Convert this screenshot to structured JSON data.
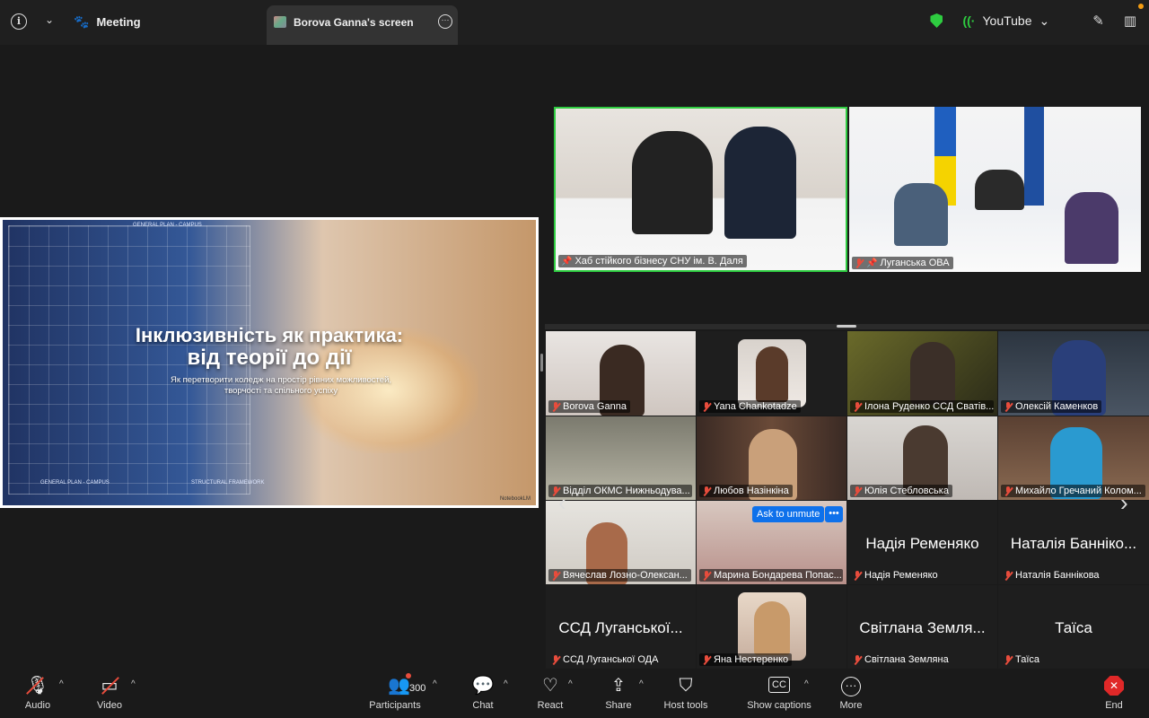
{
  "topbar": {
    "meeting_label": "Meeting",
    "tab_title": "Borova Ganna's screen",
    "stream_label": "YouTube",
    "stream_chevron": "⌄"
  },
  "slide": {
    "title_line1": "Інклюзивність як практика:",
    "title_line2": "від теорії до дії",
    "subtitle": "Як перетворити коледж на простір рівних можливостей, творчості та спільного успіху",
    "bp_label_top": "GENERAL PLAN - CAMPUS",
    "bp_label_bottom_left": "GENERAL PLAN - CAMPUS",
    "bp_label_bottom_mid": "STRUCTURAL FRAMEWORK",
    "watermark": "NotebookLM"
  },
  "participants": [
    {
      "id": "hub",
      "name": "Хаб стійкого бізнесу СНУ ім. В. Даля"
    },
    {
      "id": "lug",
      "name": "Луганська ОВА"
    },
    {
      "id": "p1",
      "name": "Borova Ganna"
    },
    {
      "id": "p2",
      "name": "Yana Chankotadze"
    },
    {
      "id": "p3",
      "name": "Ілона Руденко ССД Сватів..."
    },
    {
      "id": "p4",
      "name": "Олексій Каменков"
    },
    {
      "id": "p5",
      "name": "Відділ ОКМС Нижньодува..."
    },
    {
      "id": "p6",
      "name": "Любов Назінкіна"
    },
    {
      "id": "p7",
      "name": "Юлія Стебловська"
    },
    {
      "id": "p8",
      "name": "Михайло Гречаний Колом..."
    },
    {
      "id": "p9",
      "name": "Вячеслав Лозно-Олексан..."
    },
    {
      "id": "p10",
      "name": "Марина Бондарева Попас..."
    },
    {
      "id": "p11",
      "name": "Надія Ременяко",
      "big": "Надія Ременяко"
    },
    {
      "id": "p12",
      "name": "Наталія Баннікова",
      "big": "Наталія Баннікo..."
    },
    {
      "id": "p13",
      "name": "ССД Луганської ОДА",
      "big": "ССД Луганської..."
    },
    {
      "id": "p14",
      "name": "Яна Нестеренко"
    },
    {
      "id": "p15",
      "name": "Світлана  Земляна",
      "big": "Світлана  Земля..."
    },
    {
      "id": "p16",
      "name": "Таїса",
      "big": "Таїса"
    }
  ],
  "ask_to_unmute": "Ask to unmute",
  "ask_more": "•••",
  "toolbar": {
    "audio": "Audio",
    "video": "Video",
    "participants": "Participants",
    "participants_count": "300",
    "chat": "Chat",
    "react": "React",
    "share": "Share",
    "host_tools": "Host tools",
    "show_captions": "Show captions",
    "more": "More",
    "end": "End"
  },
  "colors": {
    "active_speaker_border": "#2ecc40",
    "mic_muted": "#e74c3c",
    "unmute_button": "#0e71eb",
    "end_button": "#e02828"
  },
  "icons": [
    "info-icon",
    "paw-icon",
    "shield-check-icon",
    "signal-icon",
    "pen-icon",
    "sidebar-icon",
    "mic-off-icon",
    "video-off-icon",
    "participants-icon",
    "chat-icon",
    "heart-icon",
    "share-icon",
    "host-shield-icon",
    "cc-icon",
    "more-icon",
    "end-icon",
    "pin-icon"
  ]
}
